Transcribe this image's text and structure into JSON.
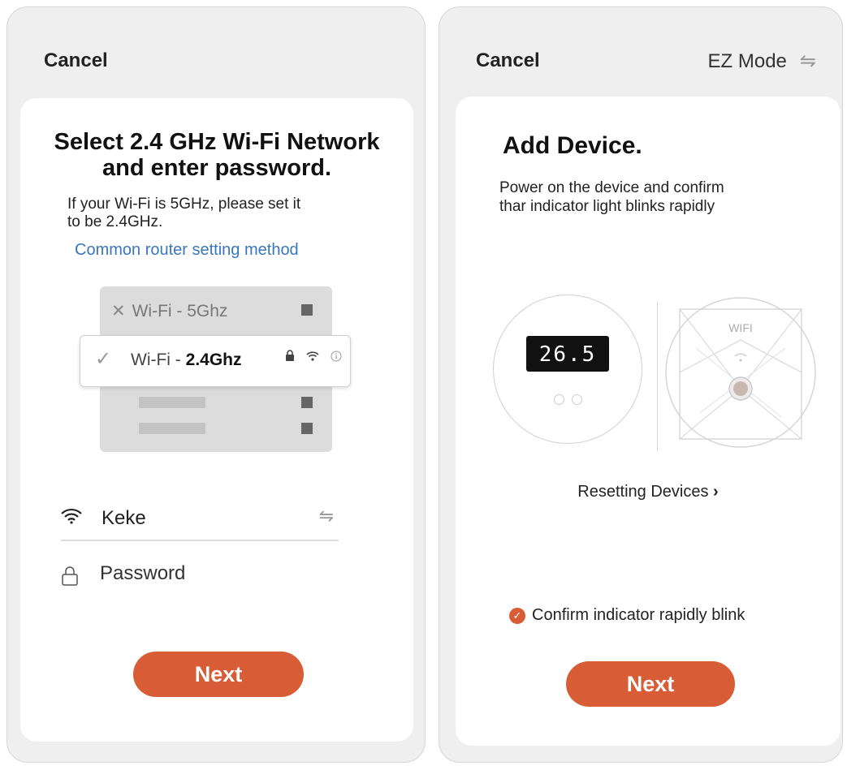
{
  "left_screen": {
    "cancel_label": "Cancel",
    "title_line1": "Select 2.4 GHz Wi-Fi Network",
    "title_line2": "and enter password.",
    "hint_line1": "If your Wi-Fi is 5GHz, please set it",
    "hint_line2": "to be 2.4GHz.",
    "router_link": "Common router setting method",
    "illustration": {
      "network_5ghz": "Wi-Fi - 5Ghz",
      "network_24_prefix": "Wi-Fi - ",
      "network_24_bold": "2.4Ghz"
    },
    "wifi_name": "Keke",
    "password_placeholder": "Password",
    "next_label": "Next"
  },
  "right_screen": {
    "cancel_label": "Cancel",
    "mode_label": "EZ Mode",
    "title": "Add Device.",
    "desc_line1": "Power on the device and confirm",
    "desc_line2": "thar indicator light blinks rapidly",
    "device_display": "26.5",
    "device_wifi_label": "WIFI",
    "resetting_link": "Resetting Devices",
    "confirm_label": "Confirm indicator rapidly blink",
    "confirm_checked": true,
    "next_label": "Next"
  },
  "icons": {
    "swap": "⇋",
    "wifi": "wifi-icon",
    "lock": "lock-icon",
    "check": "✓",
    "close": "✕",
    "chevron": "›"
  },
  "colors": {
    "accent": "#d85d36",
    "link": "#3a77b8",
    "card": "#ffffff",
    "phone_bg": "#efefef"
  }
}
